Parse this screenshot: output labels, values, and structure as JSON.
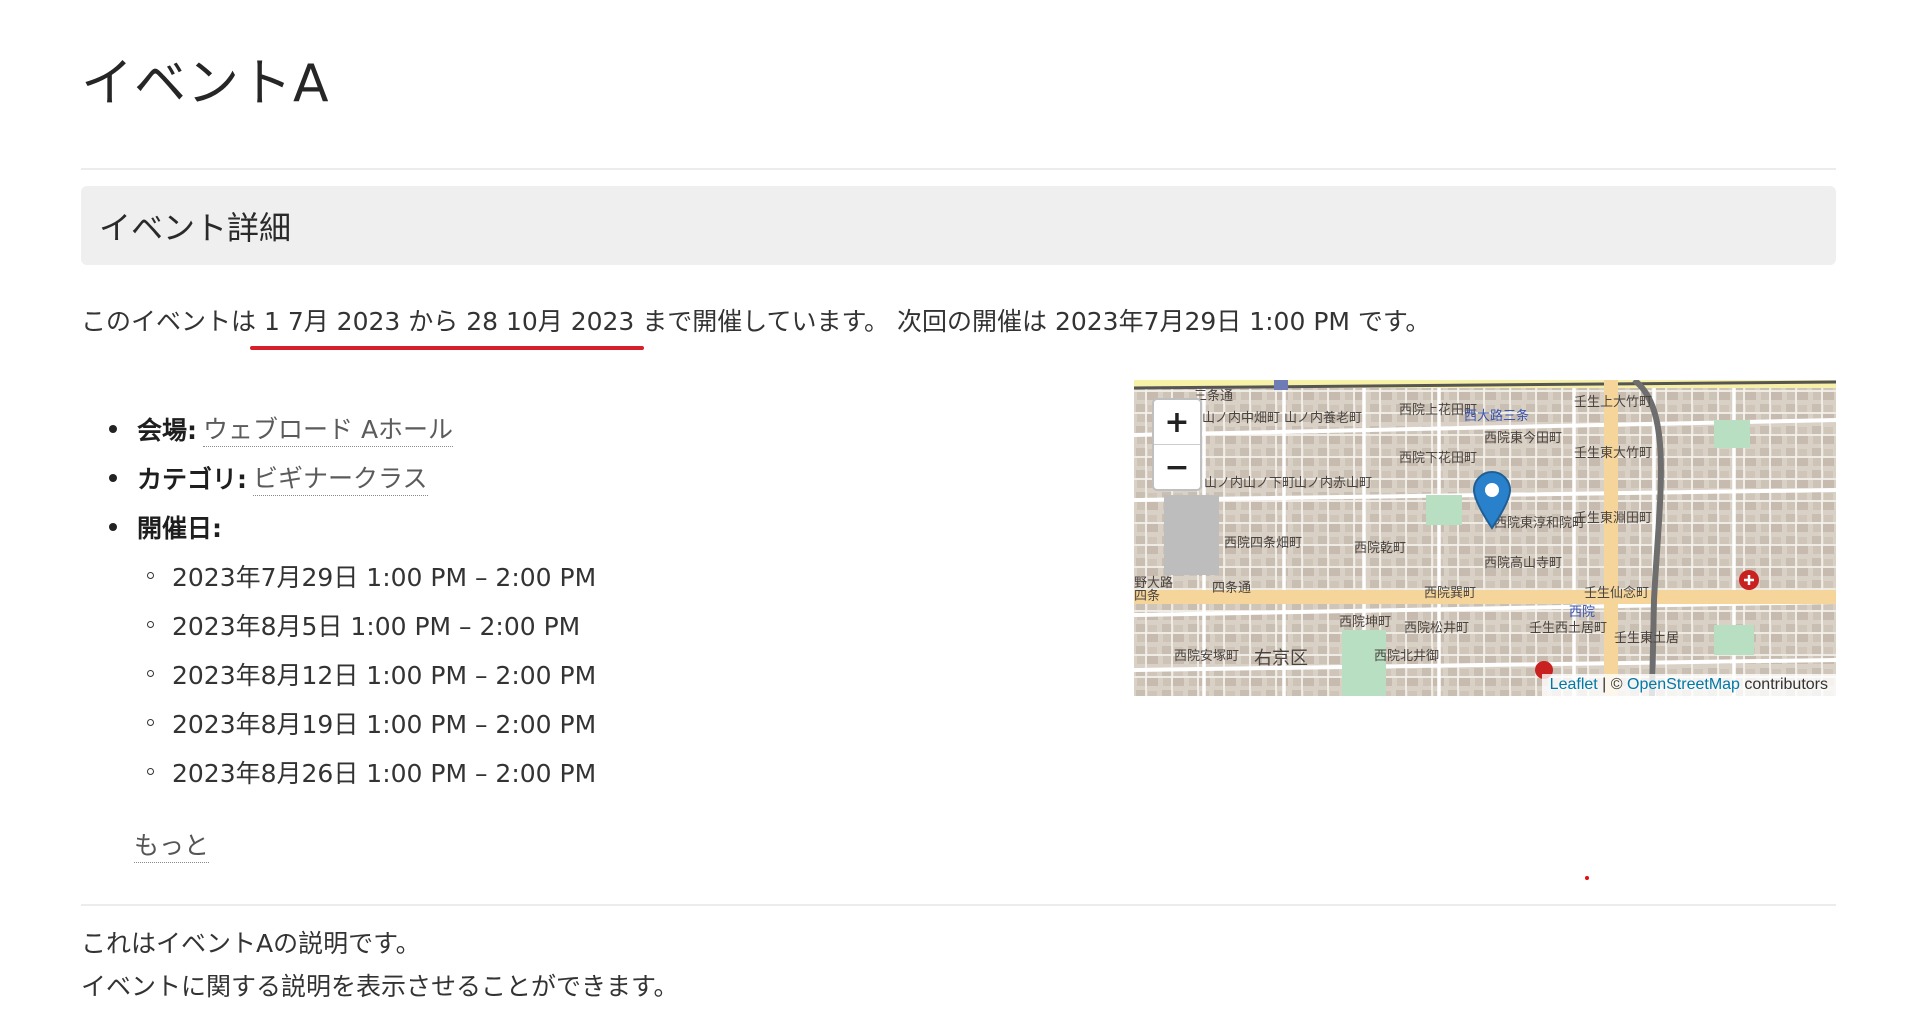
{
  "page": {
    "title": "イベントA"
  },
  "details": {
    "heading": "イベント詳細",
    "summary_prefix": "このイベントは",
    "summary_range": "1 7月 2023 から 28 10月 2023",
    "summary_suffix": "まで開催しています。 次回の開催は 2023年7月29日 1:00 PM です。"
  },
  "info": {
    "venue_label": "会場:",
    "venue_value": "ウェブロード Aホール",
    "category_label": "カテゴリ:",
    "category_value": "ビギナークラス",
    "dates_label": "開催日:",
    "dates": [
      "2023年7月29日 1:00 PM – 2:00 PM",
      "2023年8月5日 1:00 PM – 2:00 PM",
      "2023年8月12日 1:00 PM – 2:00 PM",
      "2023年8月19日 1:00 PM – 2:00 PM",
      "2023年8月26日 1:00 PM – 2:00 PM"
    ],
    "more_label": "もっと"
  },
  "map": {
    "zoom_in": "+",
    "zoom_out": "−",
    "attribution_leaflet": "Leaflet",
    "attribution_sep": " | © ",
    "attribution_osm": "OpenStreetMap",
    "attribution_suffix": " contributors",
    "labels": [
      "三条通",
      "山ノ内中畑町",
      "山ノ内養老町",
      "西院上花田町",
      "西大路三条",
      "壬生上大竹町",
      "西院東今田町",
      "西院下花田町",
      "山ノ内山ノ下町",
      "山ノ内赤山町",
      "壬生東大竹町",
      "西院東淳和院町",
      "壬生東淵田町",
      "西院四条畑町",
      "西院乾町",
      "西院高山寺町",
      "四条通",
      "西院巽町",
      "野大路",
      "四条",
      "西院坤町",
      "西院松井町",
      "壬生仙念町",
      "西院",
      "壬生西土居町",
      "壬生東土居",
      "西院安塚町",
      "右京区",
      "西院北井御"
    ],
    "accent": "#2a81cb"
  },
  "description": {
    "line1": "これはイベントAの説明です。",
    "line2": "イベントに関する説明を表示させることができます。"
  }
}
